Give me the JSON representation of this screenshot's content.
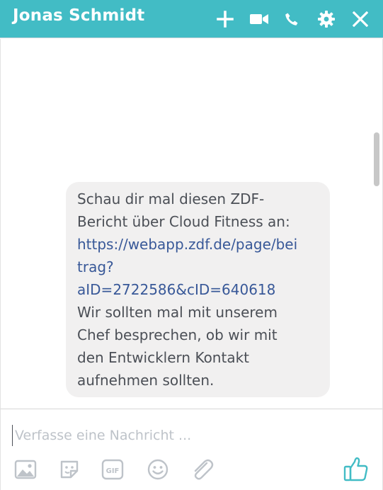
{
  "header": {
    "title": "Jonas Schmidt",
    "icons": [
      "plus-icon",
      "video-camera-icon",
      "phone-icon",
      "gear-icon",
      "close-icon"
    ],
    "background_color": "#42bcc5"
  },
  "messages": {
    "bubble_lines": {
      "l1": "Schau dir mal diesen ZDF-",
      "l2": "Bericht über Cloud Fitness an:",
      "link1": "https://webapp.zdf.de/page/bei",
      "link2": "trag?",
      "link3": "aID=2722586&cID=640618",
      "l3": "Wir sollten mal mit unserem",
      "l4": "Chef besprechen, ob wir mit",
      "l5": "den Entwicklern Kontakt",
      "l6": "aufnehmen sollten."
    },
    "link_color": "#385898"
  },
  "composer": {
    "placeholder": "Verfasse eine Nachricht ...",
    "value": "",
    "tools": [
      "image-icon",
      "sticker-icon",
      "gif-icon",
      "emoji-icon",
      "attachment-icon"
    ],
    "like_icon": "thumbs-up-icon",
    "accent_color": "#42bcc5"
  }
}
